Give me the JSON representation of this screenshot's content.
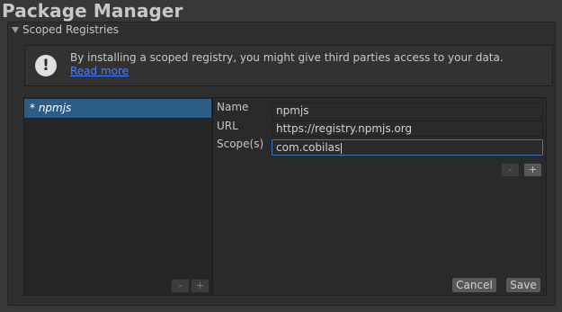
{
  "window": {
    "title": "Package Manager"
  },
  "section": {
    "title": "Scoped Registries"
  },
  "info": {
    "message": "By installing a scoped registry, you might give third parties access to your data.",
    "link": "Read more"
  },
  "registries": {
    "items": [
      {
        "label": "* npmjs"
      }
    ]
  },
  "form": {
    "name_label": "Name",
    "name_value": "npmjs",
    "url_label": "URL",
    "url_value": "https://registry.npmjs.org",
    "scopes_label": "Scope(s)",
    "scope_value": "com.cobilas"
  },
  "buttons": {
    "minus": "-",
    "plus": "+",
    "cancel": "Cancel",
    "save": "Save"
  }
}
